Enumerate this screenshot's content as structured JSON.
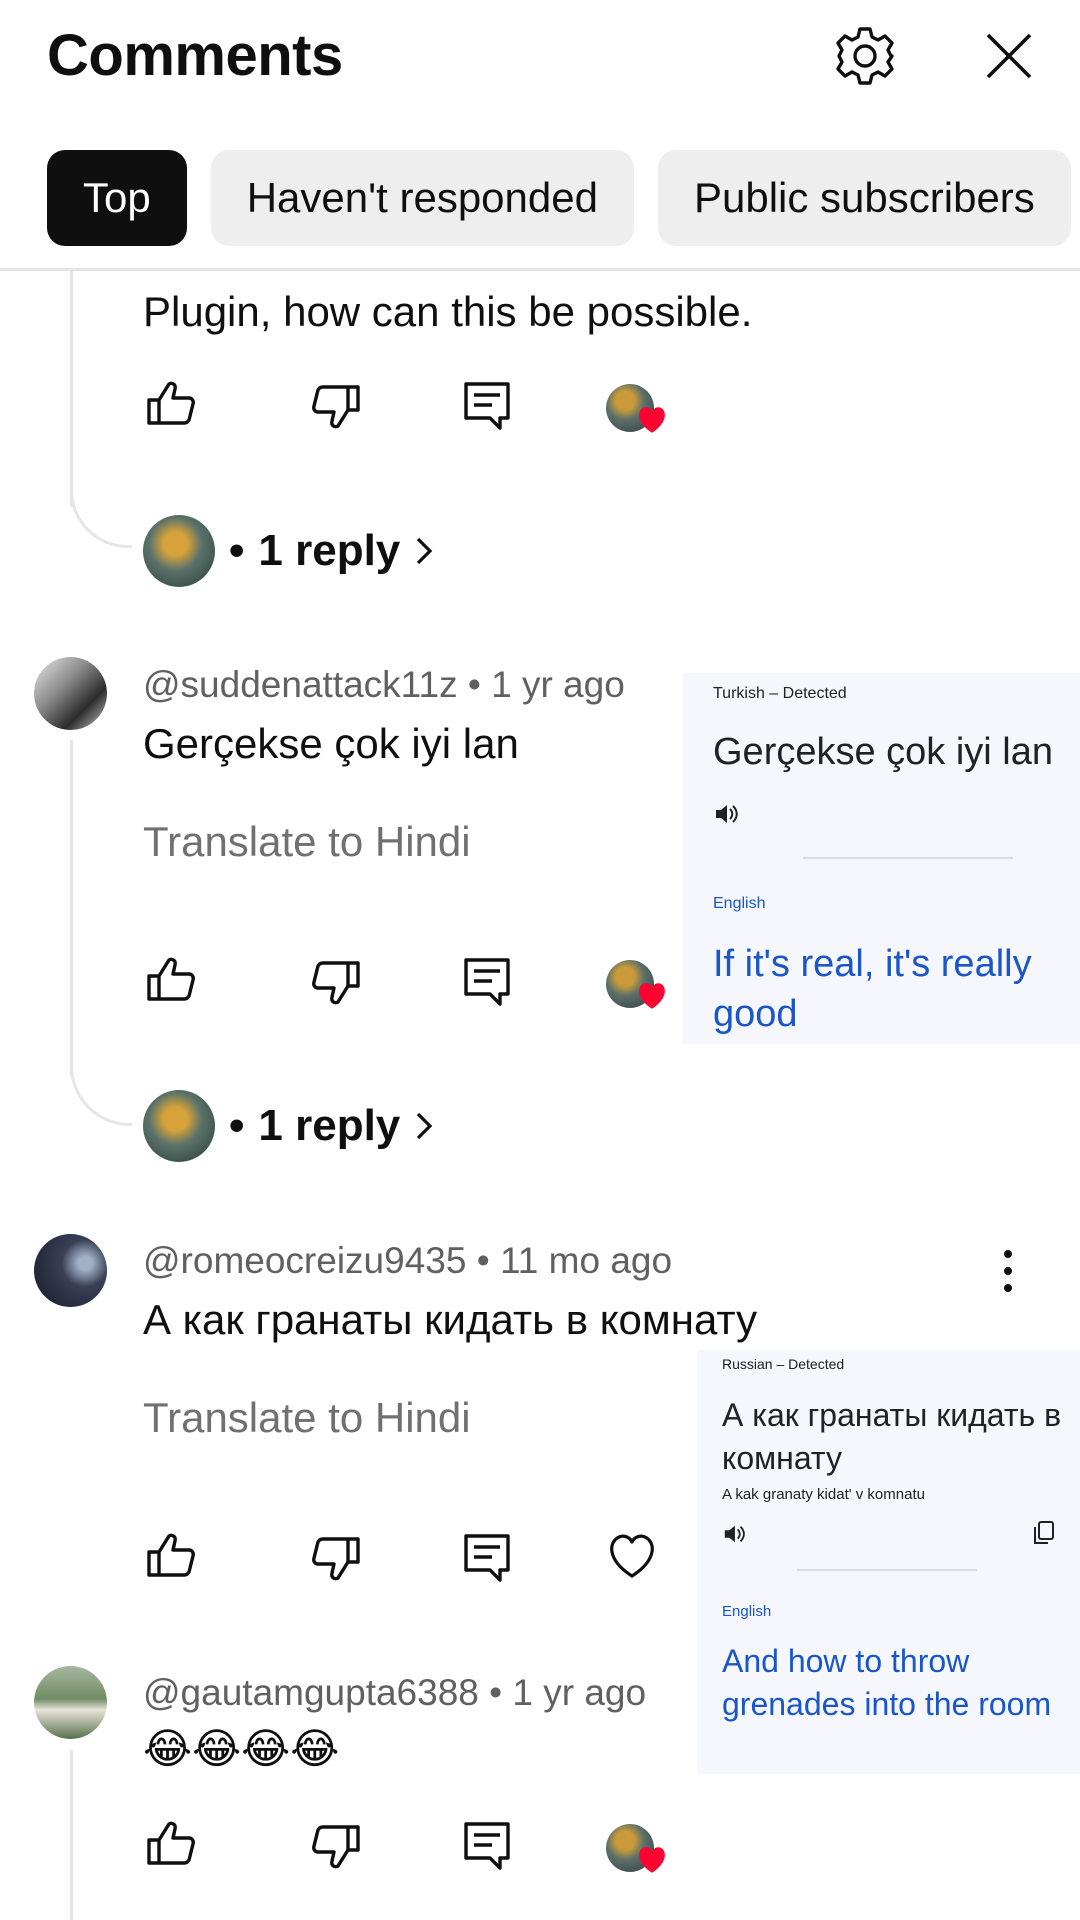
{
  "header": {
    "title": "Comments",
    "settings_icon": "gear-icon",
    "close_icon": "close-icon"
  },
  "filters": [
    {
      "label": "Top",
      "active": true
    },
    {
      "label": "Haven't responded",
      "active": false
    },
    {
      "label": "Public subscribers",
      "active": false
    }
  ],
  "partial_comment": {
    "text": "Plugin, how can this be possible.",
    "replies": "1 reply"
  },
  "comments": [
    {
      "author": "@suddenattack11z",
      "time": "1 yr ago",
      "text": "Gerçekse çok iyi lan",
      "translate": "Translate to Hindi",
      "replies": "1 reply",
      "hearted": true
    },
    {
      "author": "@romeocreizu9435",
      "time": "11 mo ago",
      "text": "А как гранаты кидать в комнату",
      "translate": "Translate to Hindi",
      "hearted": false
    },
    {
      "author": "@gautamgupta6388",
      "time": "1 yr ago",
      "text": "😂😂😂😂",
      "hearted": true
    }
  ],
  "popups": [
    {
      "source_lang": "Turkish – Detected",
      "source_text": "Gerçekse çok iyi lan",
      "target_lang": "English",
      "translation": "If it's real, it's really good"
    },
    {
      "source_lang": "Russian – Detected",
      "source_text": "А как гранаты кидать в комнату",
      "transliteration": "A kak granaty kidat' v komnatu",
      "target_lang": "English",
      "translation": "And how to throw grenades into the room"
    }
  ],
  "colors": {
    "heart": "#ff0033",
    "link_blue": "#1a56c8",
    "chip_active": "#0f0f0f",
    "chip_inactive": "#eeeeee"
  }
}
